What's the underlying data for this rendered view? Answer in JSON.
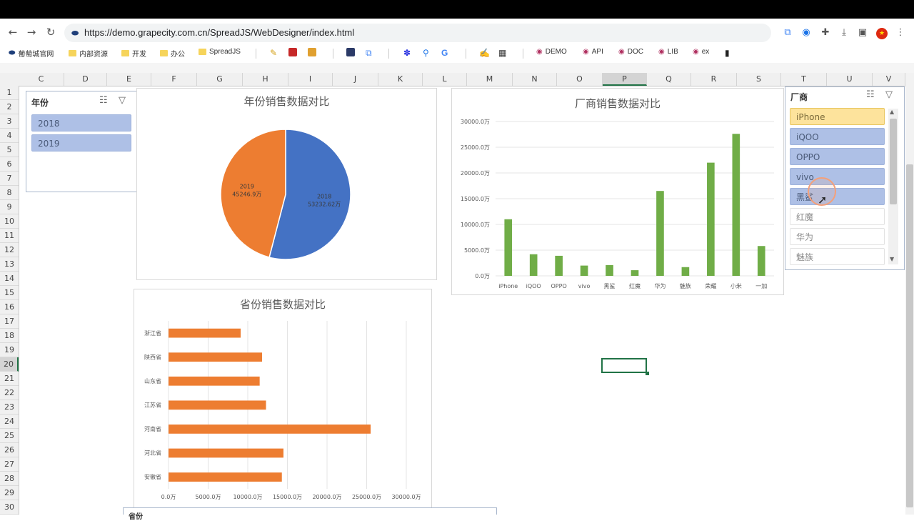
{
  "browser": {
    "url": "https://demo.grapecity.com.cn/SpreadJS/WebDesigner/index.html",
    "bookmarks": [
      "葡萄城官网",
      "内部资源",
      "开发",
      "办公",
      "SpreadJS",
      "DEMO",
      "API",
      "DOC",
      "LIB",
      "ex"
    ]
  },
  "sheet": {
    "columns": [
      "C",
      "D",
      "E",
      "F",
      "G",
      "H",
      "I",
      "J",
      "K",
      "L",
      "M",
      "N",
      "O",
      "P",
      "Q",
      "R",
      "S",
      "T",
      "U",
      "V"
    ],
    "rows": [
      "1",
      "2",
      "3",
      "4",
      "5",
      "6",
      "7",
      "8",
      "9",
      "10",
      "11",
      "12",
      "13",
      "14",
      "15",
      "16",
      "17",
      "18",
      "19",
      "20",
      "21",
      "22",
      "23",
      "24",
      "25",
      "26",
      "27",
      "28",
      "29",
      "30"
    ]
  },
  "slicer_year": {
    "title": "年份",
    "items": [
      "2018",
      "2019"
    ]
  },
  "slicer_vendor": {
    "title": "厂商",
    "items": [
      "iPhone",
      "iQOO",
      "OPPO",
      "vivo",
      "黑鲨",
      "红魔",
      "华为",
      "魅族"
    ]
  },
  "slicer_bottom": {
    "title": "省份"
  },
  "chart_data": [
    {
      "type": "pie",
      "title": "年份销售数据对比",
      "categories": [
        "2018",
        "2019"
      ],
      "values": [
        53232.62,
        45246.9
      ],
      "data_labels": [
        "2018\n53232.62万",
        "2019\n45246.9万"
      ],
      "colors": [
        "#4472c4",
        "#ed7d31"
      ]
    },
    {
      "type": "bar",
      "title": "厂商销售数据对比",
      "categories": [
        "iPhone",
        "iQOO",
        "OPPO",
        "vivo",
        "黑鲨",
        "红魔",
        "华为",
        "魅族",
        "荣耀",
        "小米",
        "一加"
      ],
      "values": [
        11000,
        4200,
        3900,
        2000,
        2100,
        1100,
        16500,
        1700,
        22000,
        27600,
        5800
      ],
      "ylim": [
        0,
        30000
      ],
      "yticks": [
        "0.0万",
        "5000.0万",
        "10000.0万",
        "15000.0万",
        "20000.0万",
        "25000.0万",
        "30000.0万"
      ],
      "grid": true,
      "color": "#70ad47"
    },
    {
      "type": "bar",
      "orientation": "horizontal",
      "title": "省份销售数据对比",
      "categories": [
        "浙江省",
        "陕西省",
        "山东省",
        "江苏省",
        "河南省",
        "河北省",
        "安徽省"
      ],
      "values": [
        9100,
        11800,
        11500,
        12300,
        25500,
        14500,
        14300
      ],
      "xlim": [
        0,
        30000
      ],
      "xticks": [
        "0.0万",
        "5000.0万",
        "10000.0万",
        "15000.0万",
        "20000.0万",
        "25000.0万",
        "30000.0万"
      ],
      "grid": true,
      "color": "#ed7d31"
    }
  ]
}
